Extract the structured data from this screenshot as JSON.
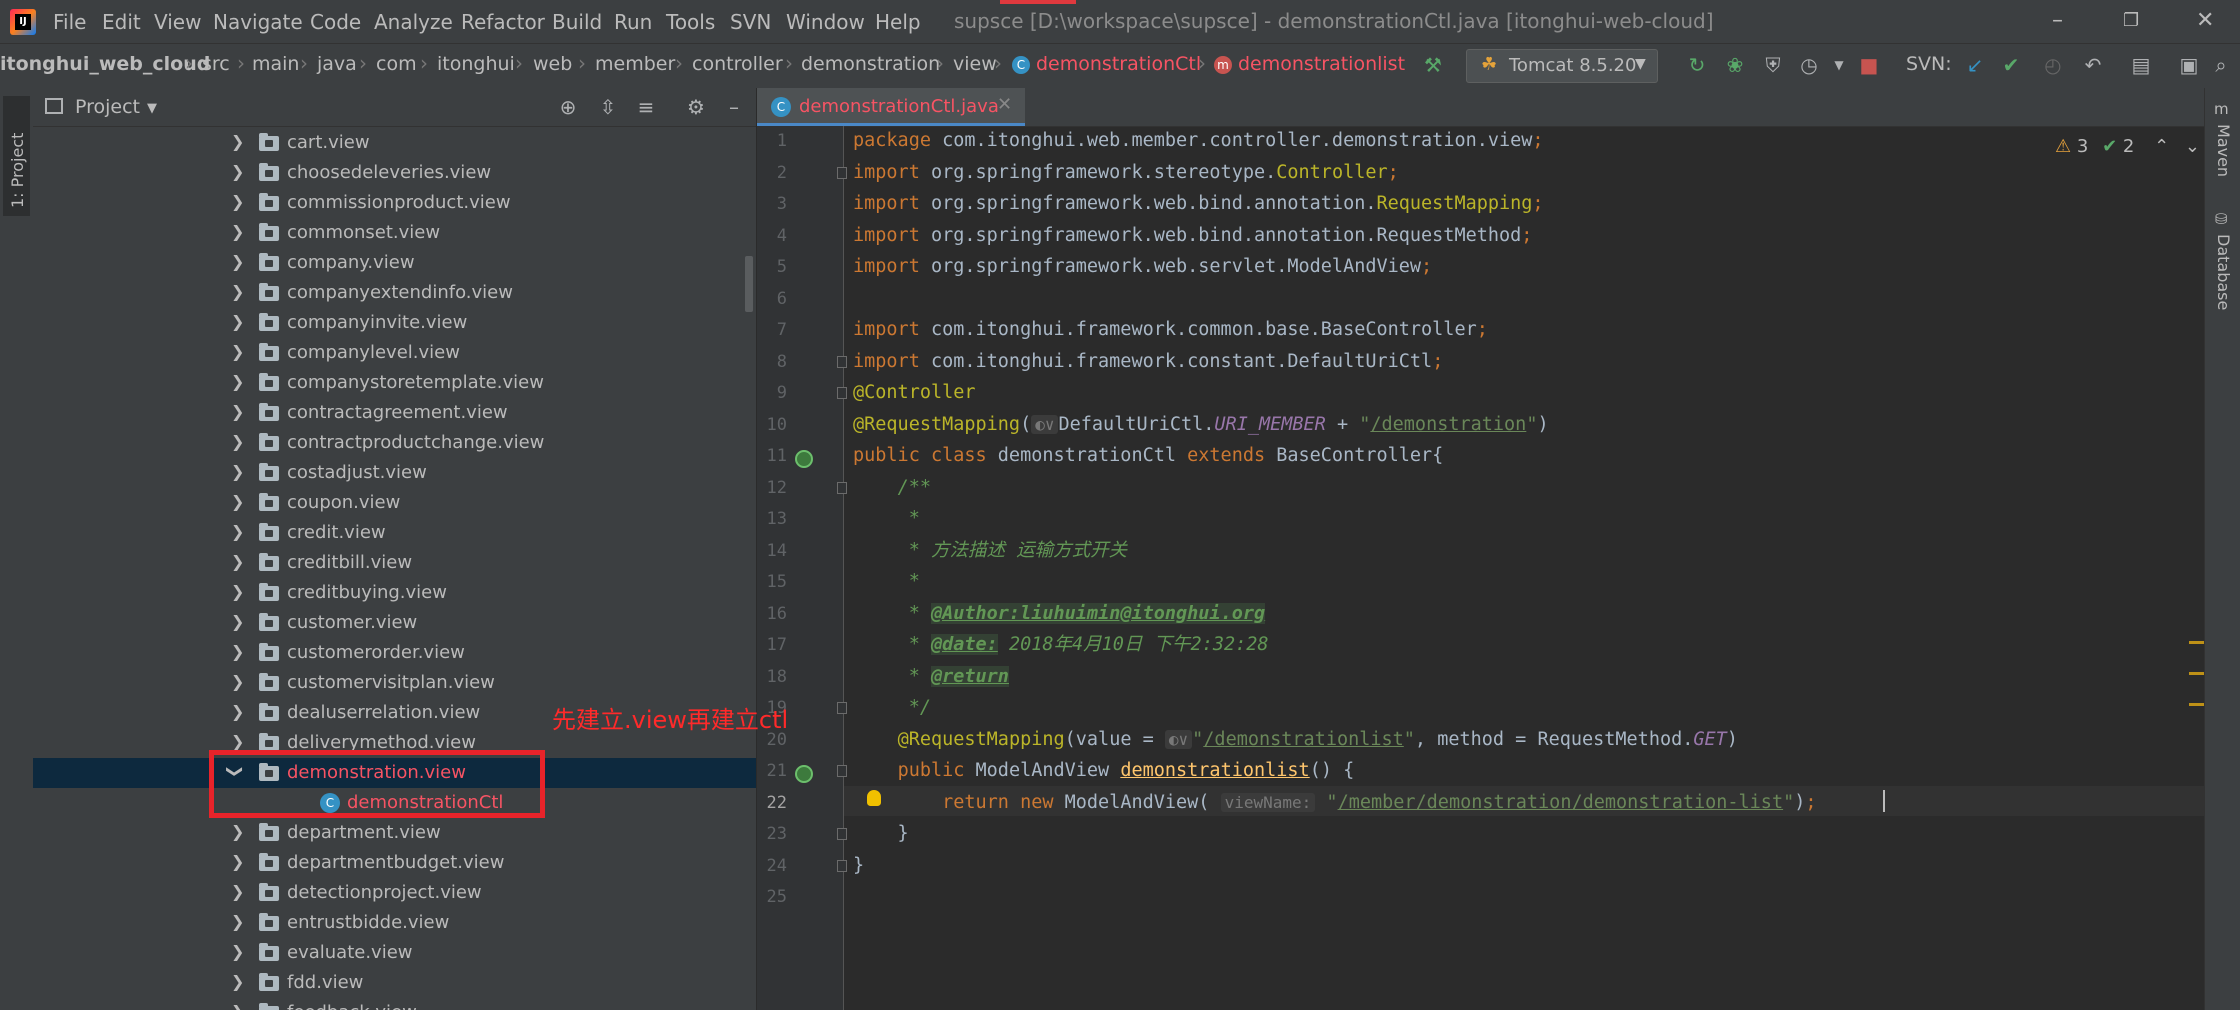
{
  "menubar": {
    "items": [
      "File",
      "Edit",
      "View",
      "Navigate",
      "Code",
      "Analyze",
      "Refactor",
      "Build",
      "Run",
      "Tools",
      "SVN",
      "Window",
      "Help"
    ],
    "title": "supsce [D:\\workspace\\supsce] - demonstrationCtl.java [itonghui-web-cloud]"
  },
  "breadcrumbs": {
    "items": [
      "itonghui_web_cloud",
      "src",
      "main",
      "java",
      "com",
      "itonghui",
      "web",
      "member",
      "controller",
      "demonstration",
      "view"
    ],
    "class_crumb": "demonstrationCtl",
    "method_crumb": "demonstrationlist"
  },
  "toolbar": {
    "run_config": "Tomcat 8.5.20",
    "svn_label": "SVN:"
  },
  "tool_windows": {
    "left_tab": "1: Project",
    "right_tabs": [
      "Maven",
      "Database"
    ]
  },
  "project": {
    "title": "Project",
    "tree": [
      {
        "label": "cart.view",
        "type": "folder"
      },
      {
        "label": "choosedeleveries.view",
        "type": "folder"
      },
      {
        "label": "commissionproduct.view",
        "type": "folder"
      },
      {
        "label": "commonset.view",
        "type": "folder"
      },
      {
        "label": "company.view",
        "type": "folder"
      },
      {
        "label": "companyextendinfo.view",
        "type": "folder"
      },
      {
        "label": "companyinvite.view",
        "type": "folder"
      },
      {
        "label": "companylevel.view",
        "type": "folder"
      },
      {
        "label": "companystoretemplate.view",
        "type": "folder"
      },
      {
        "label": "contractagreement.view",
        "type": "folder"
      },
      {
        "label": "contractproductchange.view",
        "type": "folder"
      },
      {
        "label": "costadjust.view",
        "type": "folder"
      },
      {
        "label": "coupon.view",
        "type": "folder"
      },
      {
        "label": "credit.view",
        "type": "folder"
      },
      {
        "label": "creditbill.view",
        "type": "folder"
      },
      {
        "label": "creditbuying.view",
        "type": "folder"
      },
      {
        "label": "customer.view",
        "type": "folder"
      },
      {
        "label": "customerorder.view",
        "type": "folder"
      },
      {
        "label": "customervisitplan.view",
        "type": "folder"
      },
      {
        "label": "dealuserrelation.view",
        "type": "folder"
      },
      {
        "label": "deliverymethod.view",
        "type": "folder"
      },
      {
        "label": "demonstration.view",
        "type": "folder-open"
      },
      {
        "label": "demonstrationCtl",
        "type": "class"
      },
      {
        "label": "department.view",
        "type": "folder"
      },
      {
        "label": "departmentbudget.view",
        "type": "folder"
      },
      {
        "label": "detectionproject.view",
        "type": "folder"
      },
      {
        "label": "entrustbidde.view",
        "type": "folder"
      },
      {
        "label": "evaluate.view",
        "type": "folder"
      },
      {
        "label": "fdd.view",
        "type": "folder"
      },
      {
        "label": "feedback.view",
        "type": "folder"
      }
    ]
  },
  "annotation": {
    "text": "先建立.view再建立ctl"
  },
  "editor": {
    "tab_label": "demonstrationCtl.java",
    "inspections": {
      "warnings": "3",
      "weak_warnings": "2"
    },
    "param_hint": "viewName:",
    "line_numbers": [
      "1",
      "2",
      "3",
      "4",
      "5",
      "6",
      "7",
      "8",
      "9",
      "10",
      "11",
      "12",
      "13",
      "14",
      "15",
      "16",
      "17",
      "18",
      "19",
      "20",
      "21",
      "22",
      "23",
      "24",
      "25"
    ],
    "current_line": 22
  },
  "colors": {
    "accent_red": "#f75464",
    "annotation_red": "#e8232a",
    "selection": "#0d293e",
    "keyword": "#cc7832",
    "string": "#6a8759",
    "annotation_yellow": "#bbb529"
  }
}
